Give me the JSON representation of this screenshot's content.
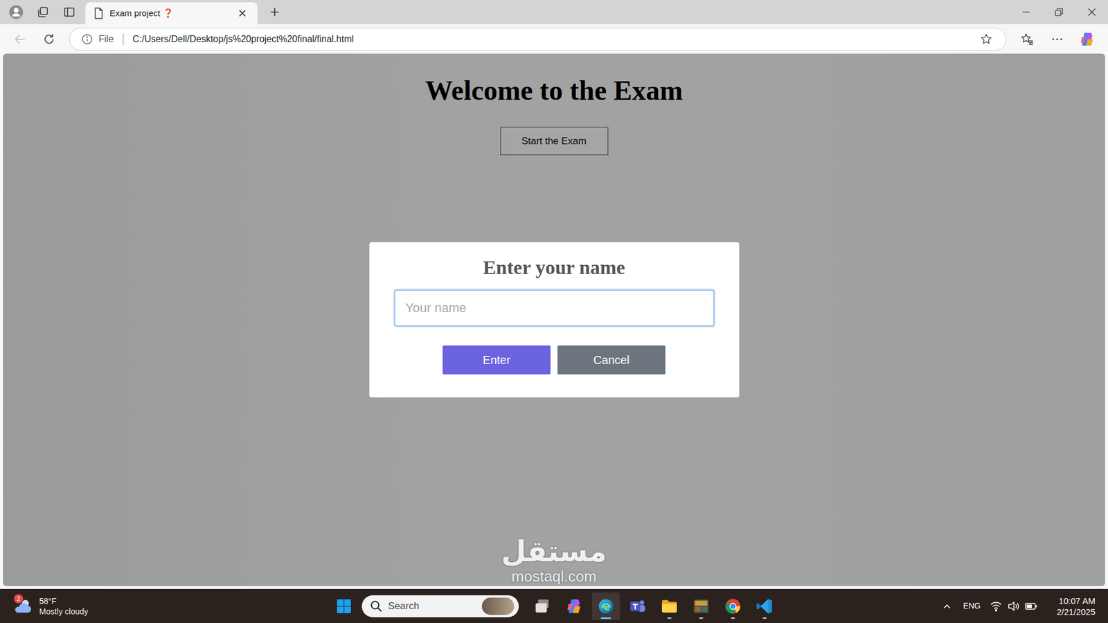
{
  "browser": {
    "tab": {
      "title": "Exam project ❓",
      "selected": true
    },
    "address": {
      "scheme": "File",
      "url": "C:/Users/Dell/Desktop/js%20project%20final/final.html"
    }
  },
  "page": {
    "heading": "Welcome to the Exam",
    "start_button": "Start the Exam",
    "watermark": {
      "arabic": "مستقل",
      "latin": "mostaql.com"
    }
  },
  "dialog": {
    "title": "Enter your name",
    "input": {
      "placeholder": "Your name",
      "value": "",
      "focused": true
    },
    "buttons": [
      {
        "label": "Enter",
        "color": "#6c63de"
      },
      {
        "label": "Cancel",
        "color": "#6c757d"
      }
    ]
  },
  "taskbar": {
    "weather": {
      "badge": "2",
      "temperature": "58°F",
      "condition": "Mostly cloudy"
    },
    "search": {
      "placeholder": "Search"
    },
    "apps": [
      {
        "kind": "taskview",
        "running": false,
        "active": false
      },
      {
        "kind": "copilot",
        "running": false,
        "active": false
      },
      {
        "kind": "edge",
        "running": true,
        "active": true
      },
      {
        "kind": "teams",
        "running": false,
        "active": false
      },
      {
        "kind": "explorer",
        "running": true,
        "active": false
      },
      {
        "kind": "game",
        "running": true,
        "active": false
      },
      {
        "kind": "chrome",
        "running": true,
        "active": false
      },
      {
        "kind": "vscode",
        "running": true,
        "active": false
      }
    ],
    "tray": {
      "language": "ENG"
    },
    "clock": {
      "time": "10:07 AM",
      "date": "2/21/2025"
    }
  }
}
